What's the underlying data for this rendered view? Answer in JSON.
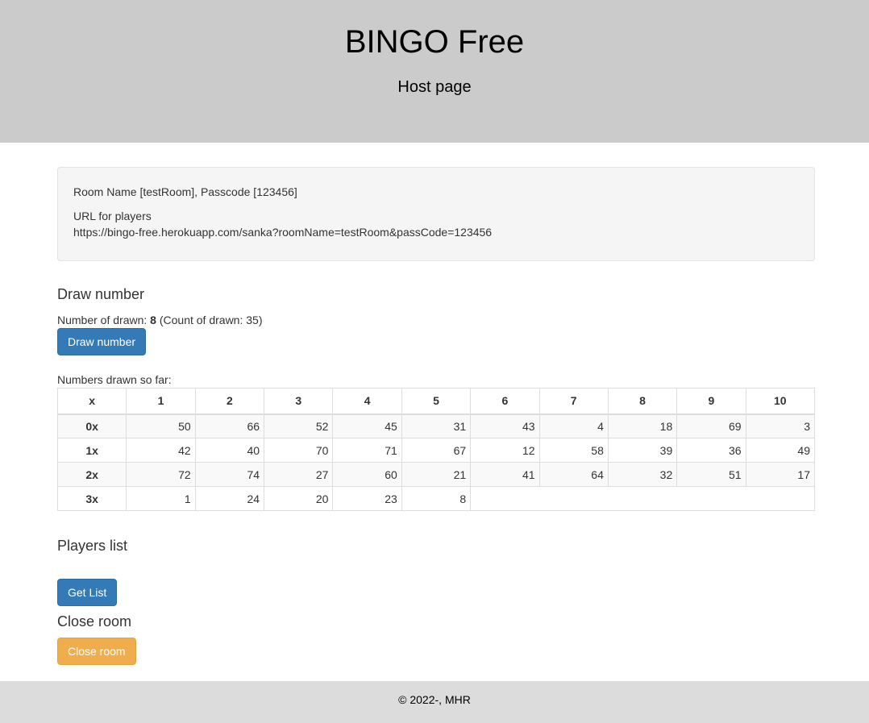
{
  "hero": {
    "title": "BINGO Free",
    "subtitle": "Host page"
  },
  "room": {
    "info": "Room Name [testRoom], Passcode [123456]",
    "url_label": "URL for players",
    "url": "https://bingo-free.herokuapp.com/sanka?roomName=testRoom&passCode=123456"
  },
  "draw": {
    "title": "Draw number",
    "prefix": "Number of drawn: ",
    "current": "8",
    "count_text": " (Count of drawn: 35)",
    "button": "Draw number"
  },
  "numbers": {
    "caption": "Numbers drawn so far:",
    "headers": [
      "x",
      "1",
      "2",
      "3",
      "4",
      "5",
      "6",
      "7",
      "8",
      "9",
      "10"
    ],
    "rows": [
      {
        "label": "0x",
        "values": [
          "50",
          "66",
          "52",
          "45",
          "31",
          "43",
          "4",
          "18",
          "69",
          "3"
        ]
      },
      {
        "label": "1x",
        "values": [
          "42",
          "40",
          "70",
          "71",
          "67",
          "12",
          "58",
          "39",
          "36",
          "49"
        ]
      },
      {
        "label": "2x",
        "values": [
          "72",
          "74",
          "27",
          "60",
          "21",
          "41",
          "64",
          "32",
          "51",
          "17"
        ]
      },
      {
        "label": "3x",
        "values": [
          "1",
          "24",
          "20",
          "23",
          "8"
        ]
      }
    ]
  },
  "players": {
    "title": "Players list",
    "button": "Get List"
  },
  "close": {
    "title": "Close room",
    "button": "Close room"
  },
  "footer": {
    "text": "© 2022-, MHR"
  },
  "colors": {
    "hero_bg": "#cbcbcb",
    "primary": "#337ab7",
    "warning": "#f0ad4e",
    "footer_bg": "#dcdcdc"
  }
}
